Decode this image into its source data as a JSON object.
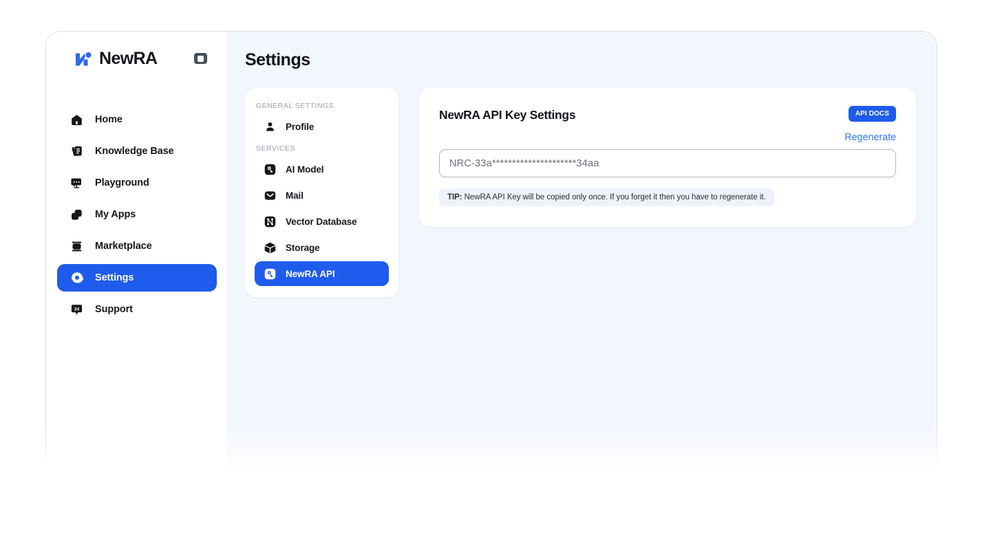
{
  "brand": {
    "name": "NewRA",
    "logo_icon": "newra-logo-icon",
    "collapse_icon": "sidebar-collapse-icon",
    "accent_color": "#1f5bec"
  },
  "sidebar": {
    "items": [
      {
        "label": "Home",
        "icon": "home-icon",
        "active": false
      },
      {
        "label": "Knowledge Base",
        "icon": "knowledge-base-icon",
        "active": false
      },
      {
        "label": "Playground",
        "icon": "playground-icon",
        "active": false
      },
      {
        "label": "My Apps",
        "icon": "my-apps-icon",
        "active": false
      },
      {
        "label": "Marketplace",
        "icon": "marketplace-icon",
        "active": false
      },
      {
        "label": "Settings",
        "icon": "gear-icon",
        "active": true
      },
      {
        "label": "Support",
        "icon": "support-24-icon",
        "active": false
      }
    ]
  },
  "page": {
    "title": "Settings"
  },
  "subnav": {
    "groups": [
      {
        "label": "GENERAL SETTINGS",
        "items": [
          {
            "label": "Profile",
            "icon": "user-icon",
            "active": false
          }
        ]
      },
      {
        "label": "SERVICES",
        "items": [
          {
            "label": "AI Model",
            "icon": "key-square-icon",
            "active": false
          },
          {
            "label": "Mail",
            "icon": "mail-icon",
            "active": false
          },
          {
            "label": "Vector Database",
            "icon": "vector-db-icon",
            "active": false
          },
          {
            "label": "Storage",
            "icon": "cube-icon",
            "active": false
          },
          {
            "label": "NewRA API",
            "icon": "key-square-icon",
            "active": true
          }
        ]
      }
    ]
  },
  "main": {
    "card_title": "NewRA API Key Settings",
    "api_docs_label": "API DOCS",
    "regenerate_label": "Regenerate",
    "api_key_value": "NRC-33a*********************34aa",
    "api_key_placeholder": "NRC-33a*********************34aa",
    "tip_prefix": "TIP:",
    "tip_text": " NewRA API Key will be copied only once. If you forget it then you have to regenerate it."
  }
}
